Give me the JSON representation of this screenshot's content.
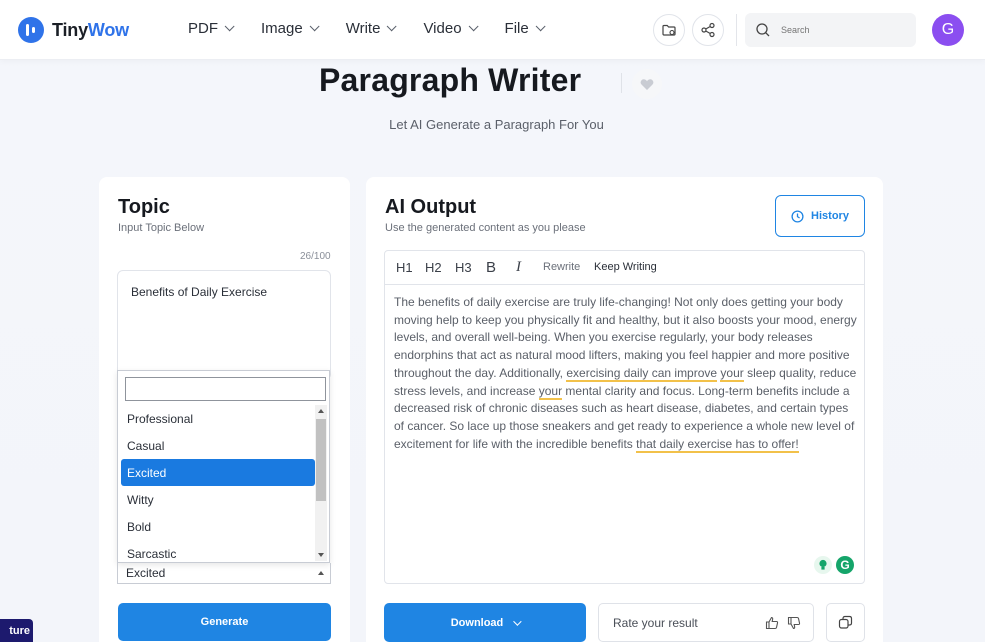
{
  "header": {
    "logo": {
      "part1": "Tiny",
      "part2": "Wow"
    },
    "nav": [
      {
        "label": "PDF"
      },
      {
        "label": "Image"
      },
      {
        "label": "Write"
      },
      {
        "label": "Video"
      },
      {
        "label": "File"
      }
    ],
    "search": {
      "placeholder": "Search"
    },
    "avatar_initial": "G"
  },
  "page": {
    "title": "Paragraph Writer",
    "subtitle": "Let AI Generate a Paragraph For You"
  },
  "topic_panel": {
    "title": "Topic",
    "subtitle": "Input Topic Below",
    "counter": "26/100",
    "topic_value": "Benefits of Daily Exercise",
    "tone_options": [
      "Professional",
      "Casual",
      "Excited",
      "Witty",
      "Bold",
      "Sarcastic"
    ],
    "tone_selected": "Excited",
    "generate_label": "Generate"
  },
  "output_panel": {
    "title": "AI Output",
    "subtitle": "Use the generated content as you please",
    "history_label": "History",
    "toolbar": {
      "h1": "H1",
      "h2": "H2",
      "h3": "H3",
      "bold": "B",
      "italic": "I",
      "rewrite": "Rewrite",
      "keep_writing": "Keep Writing"
    },
    "text": {
      "p1": "The benefits of daily exercise are truly life-changing! Not only does getting your body moving help to keep you physically fit and healthy, but it also boosts your mood, energy levels, and overall well-being. When you exercise regularly, your body releases endorphins that act as natural mood lifters, making you feel happier and more positive throughout the day. Additionally, ",
      "h1": "exercising daily can improve",
      "s1": " ",
      "h2": "your",
      "p2": " sleep quality, reduce stress levels, and increase ",
      "h3": "your",
      "p3": " mental clarity and focus. Long-term benefits include a decreased risk of chronic diseases such as heart disease, diabetes, and certain types of cancer. So lace up those sneakers and get ready to experience a whole new level of excitement for life with the incredible benefits ",
      "h4": "that daily exercise has to offer!"
    },
    "download_label": "Download",
    "rate_label": "Rate your result",
    "grammarly_letter": "G"
  },
  "feature_tab_label": "ture",
  "colors": {
    "accent": "#1f85e3",
    "brand": "#2f73e9",
    "avatar": "#8b4ef0",
    "highlight": "#f2c14a"
  }
}
